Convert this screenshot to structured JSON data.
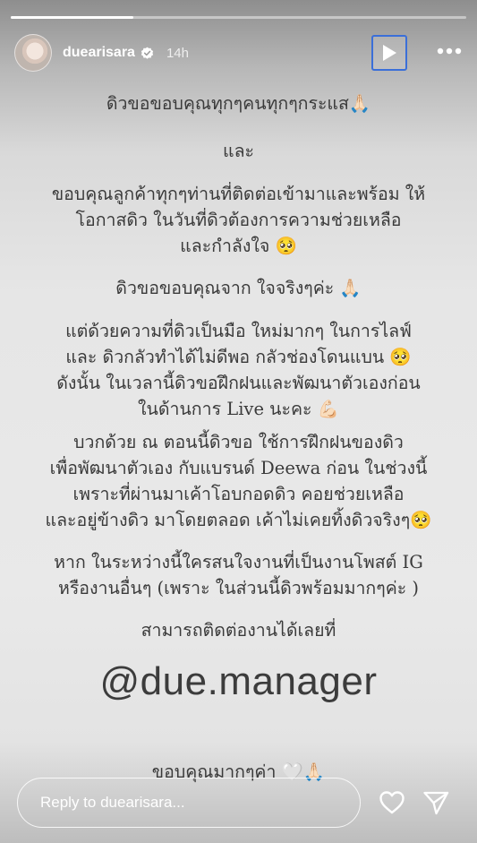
{
  "progress": {
    "fraction": 0.27
  },
  "header": {
    "username": "duearisara",
    "time": "14h",
    "avatar_icon": "profile-avatar",
    "verified_icon": "verified-badge-icon",
    "play_icon": "play-icon",
    "more_icon": "more-dots-icon"
  },
  "story": {
    "line1": "ดิวขอขอบคุณทุกๆคนทุกๆกระแส🙏🏻",
    "line2": "และ",
    "line3a": "ขอบคุณลูกค้าทุกๆท่านที่ติดต่อเข้ามาและพร้อม ให้",
    "line3b": "โอกาสดิว ในวันที่ดิวต้องการความช่วยเหลือ",
    "line3c": "และกำลังใจ 🥺",
    "line4": "ดิวขอขอบคุณจาก ใจจริงๆค่ะ 🙏🏻",
    "line5a": "แต่ด้วยความที่ดิวเป็นมือ ใหม่มากๆ ในการไลฟ์",
    "line5b": "และ ดิวกลัวทำได้ไม่ดีพอ กลัวช่องโดนแบน 🥺",
    "line5c": "ดังนั้น ในเวลานี้ดิวขอฝึกฝนและพัฒนาตัวเองก่อน",
    "line5d": "ในด้านการ Live นะคะ 💪🏻",
    "line6a": "บวกด้วย ณ ตอนนี้ดิวขอ ใช้การฝึกฝนของดิว",
    "line6b": "เพื่อพัฒนาตัวเอง กับแบรนด์ Deewa ก่อน ในช่วงนี้",
    "line6c": "เพราะที่ผ่านมาเค้าโอบกอดดิว คอยช่วยเหลือ",
    "line6d": "และอยู่ข้างดิว มาโดยตลอด เค้าไม่เคยทิ้งดิวจริงๆ🥺",
    "line7a": "หาก ในระหว่างนี้ใครสนใจงานที่เป็นงานโพสต์ IG",
    "line7b": "หรืองานอื่นๆ (เพราะ ในส่วนนี้ดิวพร้อมมากๆค่ะ )",
    "line8": "สามารถติดต่องานได้เลยที่",
    "manager": "@due.manager",
    "line9": "ขอบคุณมากๆค่า 🤍🙏🏻"
  },
  "footer": {
    "reply_placeholder": "Reply to duearisara...",
    "heart_icon": "heart-icon",
    "send_icon": "send-icon"
  }
}
